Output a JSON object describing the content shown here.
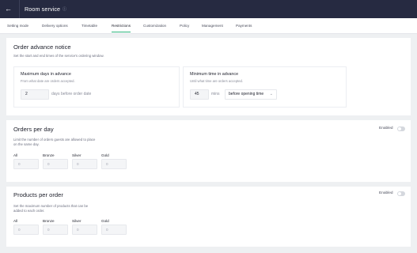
{
  "header": {
    "title": "Room service",
    "back_glyph": "←",
    "info_glyph": "ⓘ",
    "back_icon": "arrow-left-icon",
    "info_icon": "info-icon"
  },
  "tabs": [
    {
      "label": "Setting mode",
      "active": false
    },
    {
      "label": "Delivery options",
      "active": false
    },
    {
      "label": "Timetable",
      "active": false
    },
    {
      "label": "Restrictions",
      "active": true
    },
    {
      "label": "Customization",
      "active": false
    },
    {
      "label": "Policy",
      "active": false
    },
    {
      "label": "Management",
      "active": false
    },
    {
      "label": "Payments",
      "active": false
    }
  ],
  "order_advance": {
    "title": "Order advance notice",
    "description": "Set the start and end times of the service's ordering window.",
    "max_days": {
      "title": "Maximum days in advance",
      "description": "From what date are orders accepted.",
      "value": "2",
      "unit": "days before order date"
    },
    "min_time": {
      "title": "Minimum time in advance",
      "description": "Until what time are orders accepted.",
      "value": "45",
      "unit": "mins",
      "select_value": "before opening time",
      "chevron": "⌄"
    }
  },
  "orders_per_day": {
    "title": "Orders per day",
    "description_line1": "Limit the number of orders guests are allowed to place",
    "description_line2": "on the same day.",
    "toggle_label": "Enabled",
    "enabled": false,
    "tiers": [
      {
        "label": "All",
        "value": "0"
      },
      {
        "label": "Bronze",
        "value": "0"
      },
      {
        "label": "Silver",
        "value": "0"
      },
      {
        "label": "Gold",
        "value": "0"
      }
    ]
  },
  "products_per_order": {
    "title": "Products per order",
    "description_line1": "Set the maximum number of products that can be",
    "description_line2": "added to each order.",
    "toggle_label": "Enabled",
    "enabled": false,
    "tiers": [
      {
        "label": "All",
        "value": "0"
      },
      {
        "label": "Bronze",
        "value": "0"
      },
      {
        "label": "Silver",
        "value": "0"
      },
      {
        "label": "Gold",
        "value": "0"
      }
    ]
  },
  "colors": {
    "header_bg": "#262a41",
    "active_tab_underline": "#2eb67d",
    "page_bg": "#eef0f2"
  }
}
